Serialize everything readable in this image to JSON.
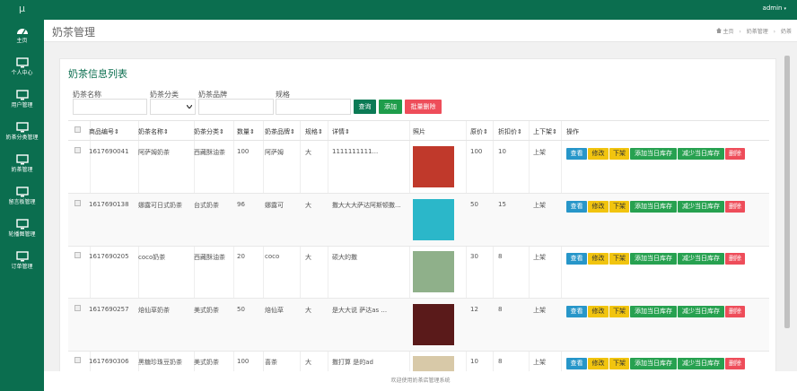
{
  "app": {
    "logo": "μ",
    "user": "admin",
    "user_caret": "▾"
  },
  "sidebar": {
    "items": [
      {
        "label": "主页",
        "icon": "dashboard-icon"
      },
      {
        "label": "个人中心",
        "icon": "monitor-icon"
      },
      {
        "label": "用户管理",
        "icon": "monitor-icon"
      },
      {
        "label": "奶茶分类管理",
        "icon": "monitor-icon"
      },
      {
        "label": "奶茶管理",
        "icon": "monitor-icon"
      },
      {
        "label": "留言板管理",
        "icon": "monitor-icon"
      },
      {
        "label": "轮播图管理",
        "icon": "monitor-icon"
      },
      {
        "label": "订单管理",
        "icon": "monitor-icon"
      }
    ]
  },
  "header": {
    "title": "奶茶管理",
    "breadcrumb": {
      "home_icon": "home-icon",
      "items": [
        "主页",
        "奶茶管理",
        "奶茶"
      ],
      "separator": "›"
    }
  },
  "panel": {
    "title": "奶茶信息列表"
  },
  "filters": {
    "name_label": "奶茶名称",
    "name_value": "",
    "category_label": "奶茶分类",
    "category_value": "",
    "brand_label": "奶茶品牌",
    "brand_value": "",
    "spec_label": "规格",
    "spec_value": ""
  },
  "buttons": {
    "search": "查询",
    "add": "添加",
    "batch_delete": "批量删除"
  },
  "table": {
    "headers": [
      "商品编号",
      "奶茶名称",
      "奶茶分类",
      "数量",
      "奶茶品牌",
      "规格",
      "详情",
      "照片",
      "原价",
      "折扣价",
      "上下架",
      "操作"
    ],
    "sortable_mark": "⇕",
    "rows": [
      {
        "id": "1617690041",
        "name": "阿萨姆奶茶",
        "category": "西藏酥油茶",
        "qty": "100",
        "brand": "阿萨姆",
        "spec": "大",
        "detail": "1111111111...",
        "price": "100",
        "discount": "10",
        "status": "上架",
        "photo_color": "#c0392b"
      },
      {
        "id": "1617690138",
        "name": "娜露可日式奶茶",
        "category": "台式奶茶",
        "qty": "96",
        "brand": "娜露可",
        "spec": "大",
        "detail": "撒大大大萨达阿斯顿撒...",
        "price": "50",
        "discount": "15",
        "status": "上架",
        "photo_color": "#2bb7c9"
      },
      {
        "id": "1617690205",
        "name": "coco奶茶",
        "category": "西藏酥油茶",
        "qty": "20",
        "brand": "coco",
        "spec": "大",
        "detail": "硕大的撒",
        "price": "30",
        "discount": "8",
        "status": "上架",
        "photo_color": "#8fb08a"
      },
      {
        "id": "1617690257",
        "name": "焙仙草奶茶",
        "category": "美式奶茶",
        "qty": "50",
        "brand": "焙仙草",
        "spec": "大",
        "detail": "是大大说 萨达as ...",
        "price": "12",
        "discount": "8",
        "status": "上架",
        "photo_color": "#5a1a1a"
      },
      {
        "id": "1617690306",
        "name": "黑糖珍珠豆奶茶",
        "category": "美式奶茶",
        "qty": "100",
        "brand": "喜茶",
        "spec": "大",
        "detail": "撒打算 是的ad",
        "price": "10",
        "discount": "8",
        "status": "上架",
        "photo_color": "#d8c9a8"
      }
    ],
    "actions": [
      "查看",
      "修改",
      "下架",
      "添加当日库存",
      "减少当日库存",
      "删除"
    ]
  },
  "colors": {
    "brand": "#0b6e4f",
    "search": "#0b7a55",
    "add": "#1e9d4b",
    "danger": "#ee4d5a",
    "view": "#2796c9",
    "edit": "#f1c40f",
    "offshelf": "#f1c40f",
    "stock": "#27a150"
  },
  "footer": {
    "text": "欢迎使用奶茶店管理系统"
  }
}
